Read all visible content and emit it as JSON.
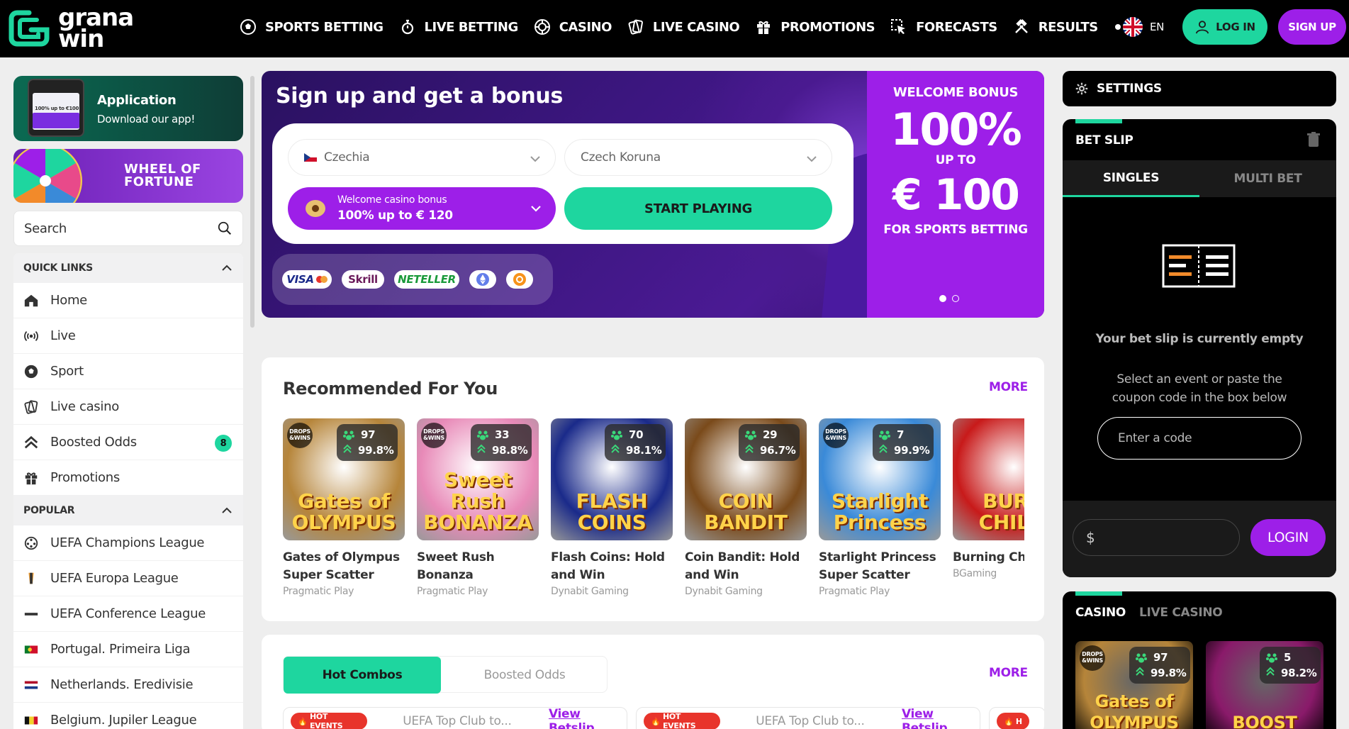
{
  "brand": {
    "line1": "grana",
    "line2": "win",
    "accent": "#1ed69f",
    "purple": "#9d1fe8"
  },
  "nav": [
    {
      "label": "SPORTS BETTING",
      "icon": "soccer-ball-icon"
    },
    {
      "label": "LIVE BETTING",
      "icon": "stopwatch-icon"
    },
    {
      "label": "CASINO",
      "icon": "chip-icon"
    },
    {
      "label": "LIVE CASINO",
      "icon": "cards-icon"
    },
    {
      "label": "PROMOTIONS",
      "icon": "gift-icon"
    },
    {
      "label": "FORECASTS",
      "icon": "cursor-icon"
    },
    {
      "label": "RESULTS",
      "icon": "hammers-icon"
    }
  ],
  "header": {
    "lang": "EN",
    "login": "LOG IN",
    "signup": "SIGN UP"
  },
  "sidebar": {
    "app_title": "Application",
    "app_sub": "Download our app!",
    "app_phone": "100% up to €100",
    "wheel_line1": "WHEEL OF",
    "wheel_line2": "FORTUNE",
    "search_placeholder": "Search",
    "quick_links_title": "QUICK LINKS",
    "quick_links": [
      {
        "label": "Home",
        "icon": "home-icon"
      },
      {
        "label": "Live",
        "icon": "broadcast-icon"
      },
      {
        "label": "Sport",
        "icon": "soccer-ball-icon"
      },
      {
        "label": "Live casino",
        "icon": "cards-icon"
      },
      {
        "label": "Boosted Odds",
        "icon": "boost-icon",
        "badge": "8"
      },
      {
        "label": "Promotions",
        "icon": "gift-icon"
      }
    ],
    "popular_title": "POPULAR",
    "popular": [
      {
        "label": "UEFA Champions League",
        "icon": "ucl-icon"
      },
      {
        "label": "UEFA Europa League",
        "icon": "uel-icon"
      },
      {
        "label": "UEFA Conference League",
        "icon": "uecl-icon"
      },
      {
        "label": "Portugal. Primeira Liga",
        "icon": "portugal-flag-icon"
      },
      {
        "label": "Netherlands. Eredivisie",
        "icon": "netherlands-flag-icon"
      },
      {
        "label": "Belgium. Jupiler League",
        "icon": "belgium-flag-icon"
      }
    ]
  },
  "hero": {
    "title": "Sign up and get a bonus",
    "country": "Czechia",
    "currency": "Czech Koruna",
    "bonus_line1": "Welcome casino bonus",
    "bonus_line2": "100% up to € 120",
    "start": "START PLAYING",
    "payments": [
      "VISA",
      "Skrill",
      "NETELLER"
    ],
    "welcome_1": "WELCOME BONUS",
    "welcome_2": "100%",
    "welcome_3": "UP TO",
    "welcome_4": "€ 100",
    "welcome_5": "FOR SPORTS BETTING"
  },
  "recommended": {
    "title": "Recommended For You",
    "more": "MORE",
    "games": [
      {
        "name_1": "Gates of Olympus",
        "name_2": "Super Scatter",
        "provider": "Pragmatic Play",
        "count": "97",
        "rtp": "99.8%",
        "drops": true,
        "art": "Gates of OLYMPUS",
        "bg": "#b6853a"
      },
      {
        "name_1": "Sweet Rush Bonanza",
        "name_2": "",
        "provider": "Pragmatic Play",
        "count": "33",
        "rtp": "98.8%",
        "drops": true,
        "art": "Sweet Rush BONANZA",
        "bg": "#e88ab8"
      },
      {
        "name_1": "Flash Coins: Hold",
        "name_2": "and Win",
        "provider": "Dynabit Gaming",
        "count": "70",
        "rtp": "98.1%",
        "drops": false,
        "art": "FLASH COINS",
        "bg": "#1a2a8a"
      },
      {
        "name_1": "Coin Bandit: Hold",
        "name_2": "and Win",
        "provider": "Dynabit Gaming",
        "count": "29",
        "rtp": "96.7%",
        "drops": false,
        "art": "COIN BANDIT",
        "bg": "#7a4a1a"
      },
      {
        "name_1": "Starlight Princess",
        "name_2": "Super Scatter",
        "provider": "Pragmatic Play",
        "count": "7",
        "rtp": "99.9%",
        "drops": true,
        "art": "Starlight Princess",
        "bg": "#3a8ad8"
      },
      {
        "name_1": "Burning Chilli",
        "name_2": "",
        "provider": "BGaming",
        "count": "",
        "rtp": "",
        "drops": false,
        "art": "BURN CHILLI",
        "bg": "#c81a1a"
      }
    ]
  },
  "combos": {
    "tab_active": "Hot Combos",
    "tab_inactive": "Boosted Odds",
    "more": "MORE",
    "events": [
      {
        "tag": "HOT EVENTS",
        "title": "UEFA Top Club to...",
        "link": "View Betslip"
      },
      {
        "tag": "HOT EVENTS",
        "title": "UEFA Top Club to...",
        "link": "View Betslip"
      }
    ]
  },
  "betslip": {
    "settings": "SETTINGS",
    "title": "BET SLIP",
    "tab_singles": "SINGLES",
    "tab_multi": "MULTI BET",
    "empty": "Your bet slip is currently empty",
    "hint": "Select an event or paste the coupon code in the box below",
    "code_placeholder": "Enter a code",
    "stake_placeholder": "$",
    "login": "LOGIN"
  },
  "casino_box": {
    "tab_casino": "CASINO",
    "tab_live": "LIVE CASINO",
    "games": [
      {
        "count": "97",
        "rtp": "99.8%",
        "bg": "#b6853a",
        "art": "Gates of OLYMPUS"
      },
      {
        "count": "5",
        "rtp": "98.2%",
        "bg": "#8a1a6a",
        "art": "BOOST"
      }
    ]
  }
}
